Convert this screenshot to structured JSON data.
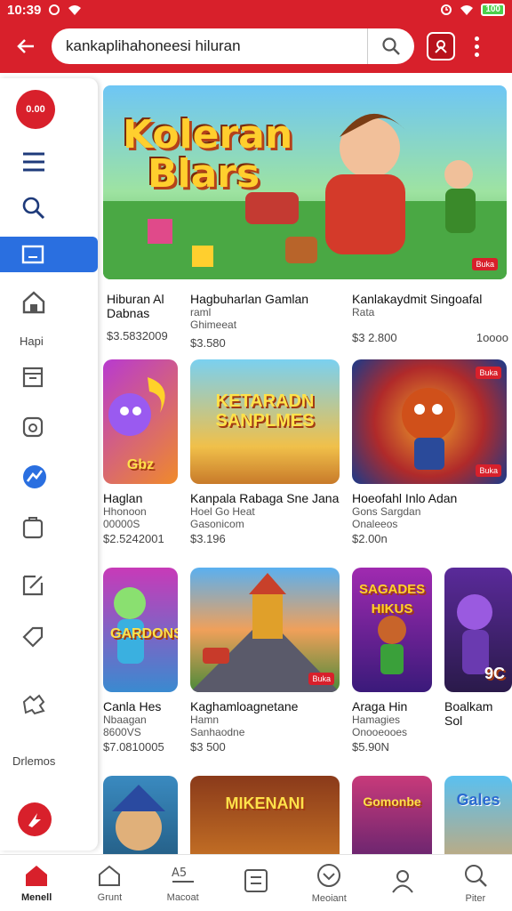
{
  "status_bar": {
    "time": "10:39",
    "battery_label": "100"
  },
  "search": {
    "query": "kankaplihahoneesi hiluran"
  },
  "sidebar": {
    "logo_text": "0.00",
    "section_label": "Hapi",
    "bottom_label": "Drlemos"
  },
  "banner": {
    "title_line1": "Koleran",
    "title_line2": "Blars",
    "badge": "Buka"
  },
  "cards": [
    {
      "title": "Hiburan Al Dabnas",
      "sub": "",
      "price": "$3.5832009",
      "extra": ""
    },
    {
      "title": "Hagbuharlan Gamlan",
      "sub": "raml",
      "sub2": "Ghimeeat",
      "price": "$3.580",
      "extra": ""
    },
    {
      "title": "Kanlakaydmit Singoafal",
      "sub": "Rata",
      "price": "$3 2.800",
      "extra": "1oooo"
    },
    {
      "title": "Haglan",
      "sub": "Hhonoon",
      "sub2": "00000S",
      "price": "$2.5242001",
      "art": "Gbz"
    },
    {
      "title": "Kanpala Rabaga Sne Jana",
      "sub": "Hoel Go Heat",
      "sub2": "Gasonicom",
      "price": "$3.196",
      "art": "KETARADN SANPLMES"
    },
    {
      "title": "Hoeofahl Inlo Adan",
      "sub": "Gons Sargdan",
      "sub2": "Onaleeos",
      "price": "$2.00n",
      "badge1": "Buka",
      "badge2": "Buka"
    },
    {
      "title": "Canla Hes",
      "sub": "Nbaagan",
      "sub2": "8600VS",
      "price": "$7.0810005",
      "art": "GARDONS"
    },
    {
      "title": "Kaghamloagnetane",
      "sub": "Hamn",
      "sub2": "Sanhaodne",
      "price": "$3 500",
      "badge1": "Buka"
    },
    {
      "title": "Araga Hin",
      "sub": "Hamagies",
      "sub2": "Onooeooes",
      "price": "$5.90N",
      "art": "SAGADES HIKUS"
    },
    {
      "title": "Boalkam Sol",
      "sub": "",
      "price": "",
      "art": "9C"
    },
    {
      "title": "",
      "art": ""
    },
    {
      "title": "",
      "art": "MIKENANI"
    },
    {
      "title": "",
      "art": "Gomonbe"
    },
    {
      "title": "",
      "art": "Gales"
    }
  ],
  "bottom_nav": [
    {
      "label": "Menell"
    },
    {
      "label": "Grunt"
    },
    {
      "label": "Macoat"
    },
    {
      "label": ""
    },
    {
      "label": "Meoiant"
    },
    {
      "label": ""
    },
    {
      "label": "Piter"
    }
  ],
  "colors": {
    "brand": "#d8202b",
    "active_sidebar": "#2a6fe0"
  }
}
